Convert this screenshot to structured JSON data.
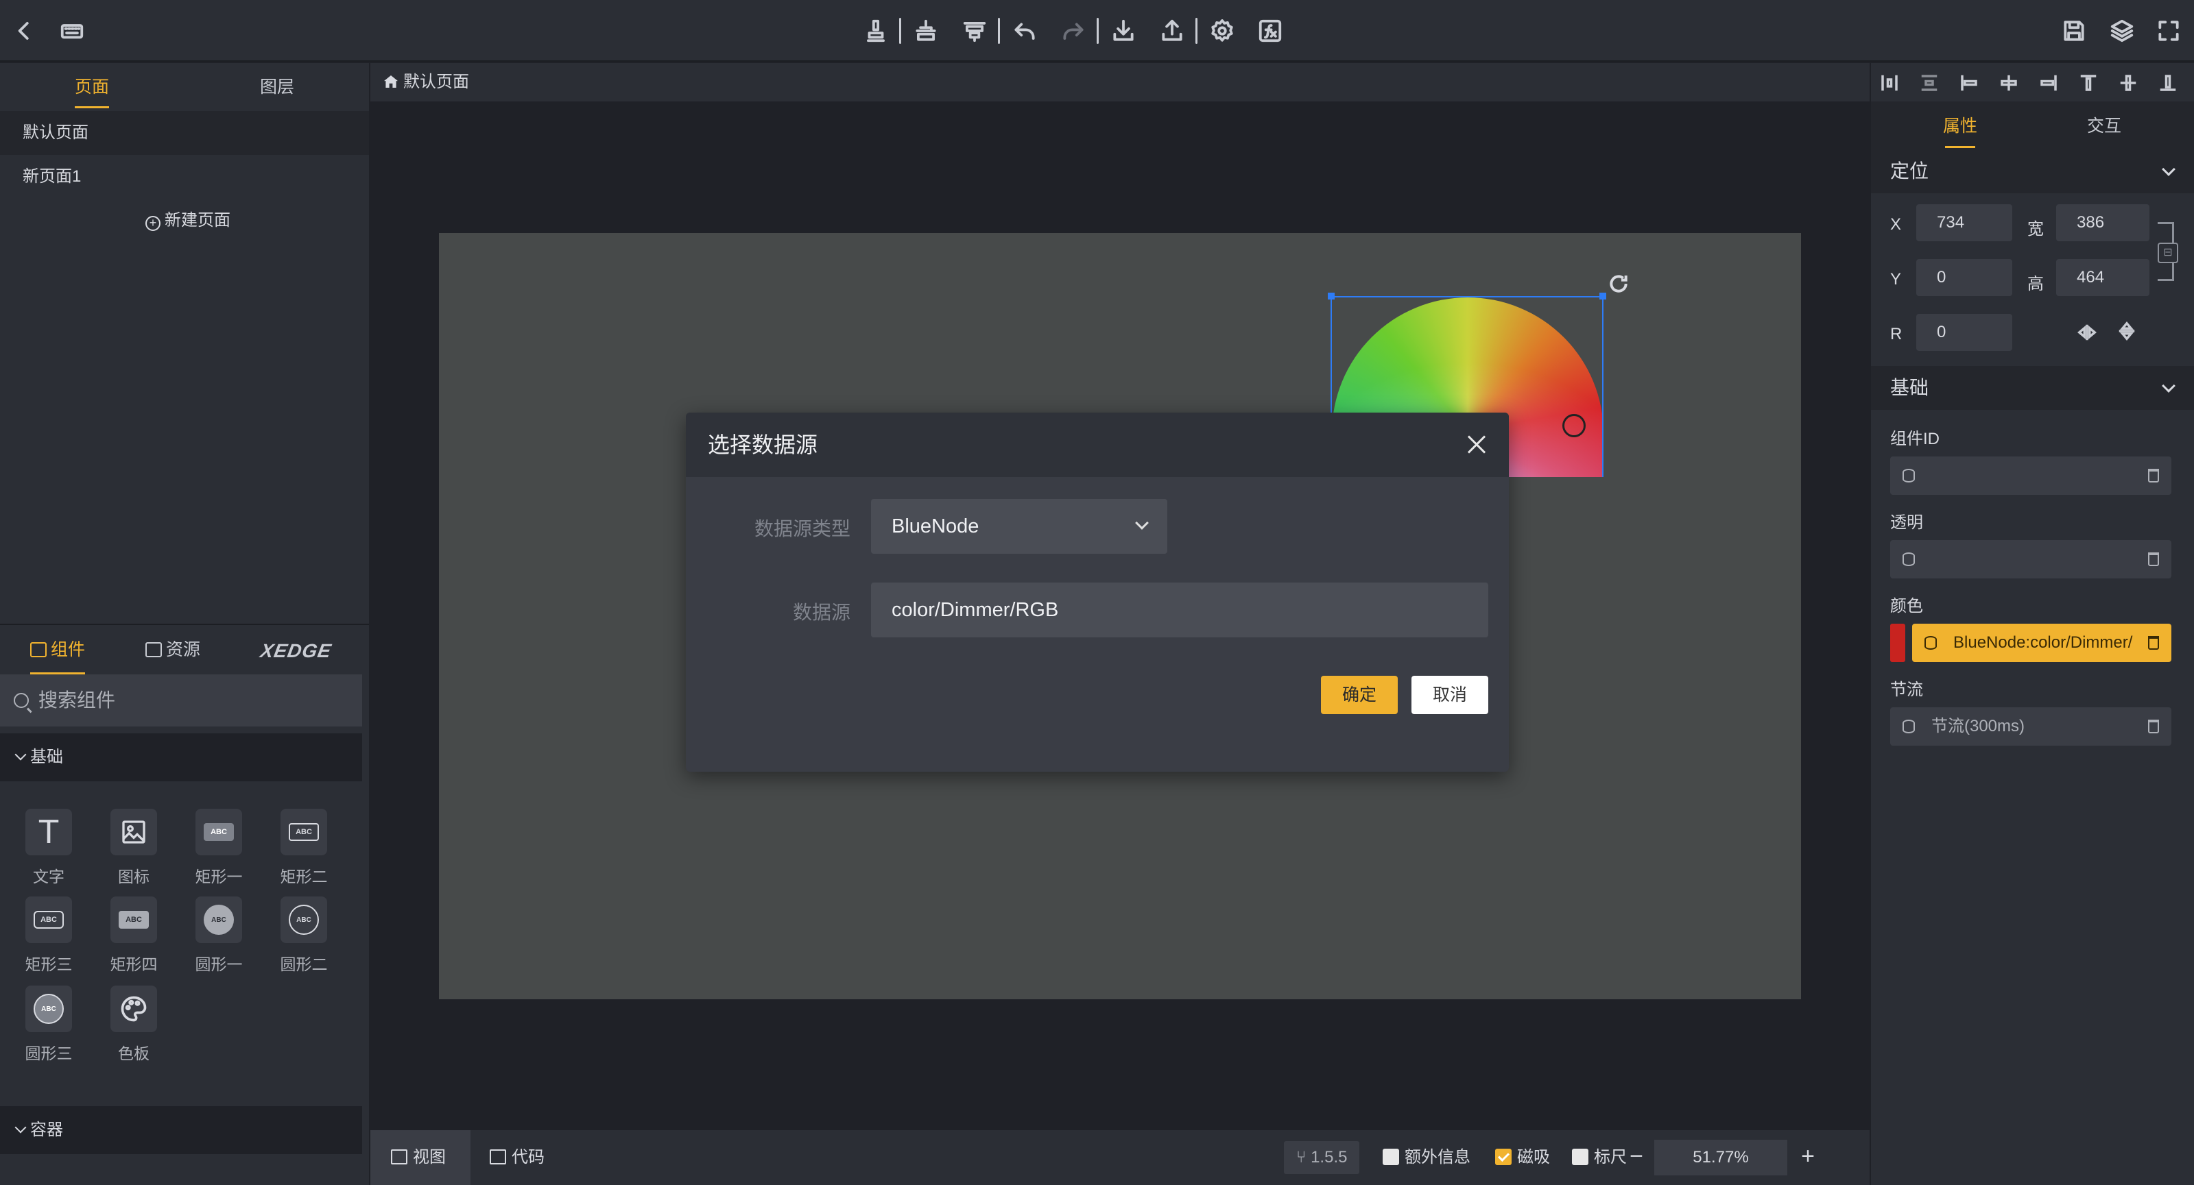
{
  "toolbar": {
    "left_icons": [
      "back-icon",
      "keyboard-icon"
    ],
    "center_icons": [
      "stamp-icon",
      "align-middle-icon",
      "align-top-icon",
      "undo-icon",
      "redo-icon",
      "download-icon",
      "upload-icon",
      "settings-icon",
      "function-icon"
    ],
    "right_icons": [
      "save-icon",
      "layers-icon",
      "fullscreen-icon"
    ]
  },
  "left_panel": {
    "tabs": [
      "页面",
      "图层"
    ],
    "pages": [
      "默认页面",
      "新页面1"
    ],
    "new_page": "新建页面",
    "component_tabs": [
      "组件",
      "资源"
    ],
    "brand": "XEDGE",
    "search_placeholder": "搜索组件",
    "group_basic": "基础",
    "group_container": "容器",
    "components": [
      {
        "label": "文字",
        "icon": "text-icon"
      },
      {
        "label": "图标",
        "icon": "image-icon"
      },
      {
        "label": "矩形一",
        "icon": "rect-icon"
      },
      {
        "label": "矩形二",
        "icon": "rect-icon"
      },
      {
        "label": "矩形三",
        "icon": "rect-icon"
      },
      {
        "label": "矩形四",
        "icon": "rect-icon"
      },
      {
        "label": "圆形一",
        "icon": "circle-icon"
      },
      {
        "label": "圆形二",
        "icon": "circle-icon"
      },
      {
        "label": "圆形三",
        "icon": "circle-icon"
      },
      {
        "label": "色板",
        "icon": "palette-icon"
      }
    ],
    "abc": "ABC"
  },
  "center": {
    "breadcrumb": "默认页面",
    "status": {
      "view": "视图",
      "code": "代码",
      "version": "1.5.5",
      "extra_info": "额外信息",
      "snap": "磁吸",
      "ruler": "标尺",
      "zoom": "51.77%",
      "snap_checked": true
    }
  },
  "modal": {
    "title": "选择数据源",
    "type_label": "数据源类型",
    "type_value": "BlueNode",
    "source_label": "数据源",
    "source_value": "color/Dimmer/RGB",
    "ok": "确定",
    "cancel": "取消"
  },
  "right_panel": {
    "tabs": [
      "属性",
      "交互"
    ],
    "position_section": "定位",
    "x_label": "X",
    "x_value": "734",
    "w_label": "宽",
    "w_value": "386",
    "y_label": "Y",
    "y_value": "0",
    "h_label": "高",
    "h_value": "464",
    "r_label": "R",
    "r_value": "0",
    "basic_section": "基础",
    "component_id_label": "组件ID",
    "opacity_label": "透明",
    "color_label": "颜色",
    "color_binding": "BlueNode:color/Dimmer/",
    "throttle_label": "节流",
    "throttle_value": "节流(300ms)",
    "color_swatch": "#c8231f"
  },
  "colors": {
    "accent": "#f1b32f",
    "selection": "#2e7cf6",
    "panel": "#2b2e35"
  }
}
